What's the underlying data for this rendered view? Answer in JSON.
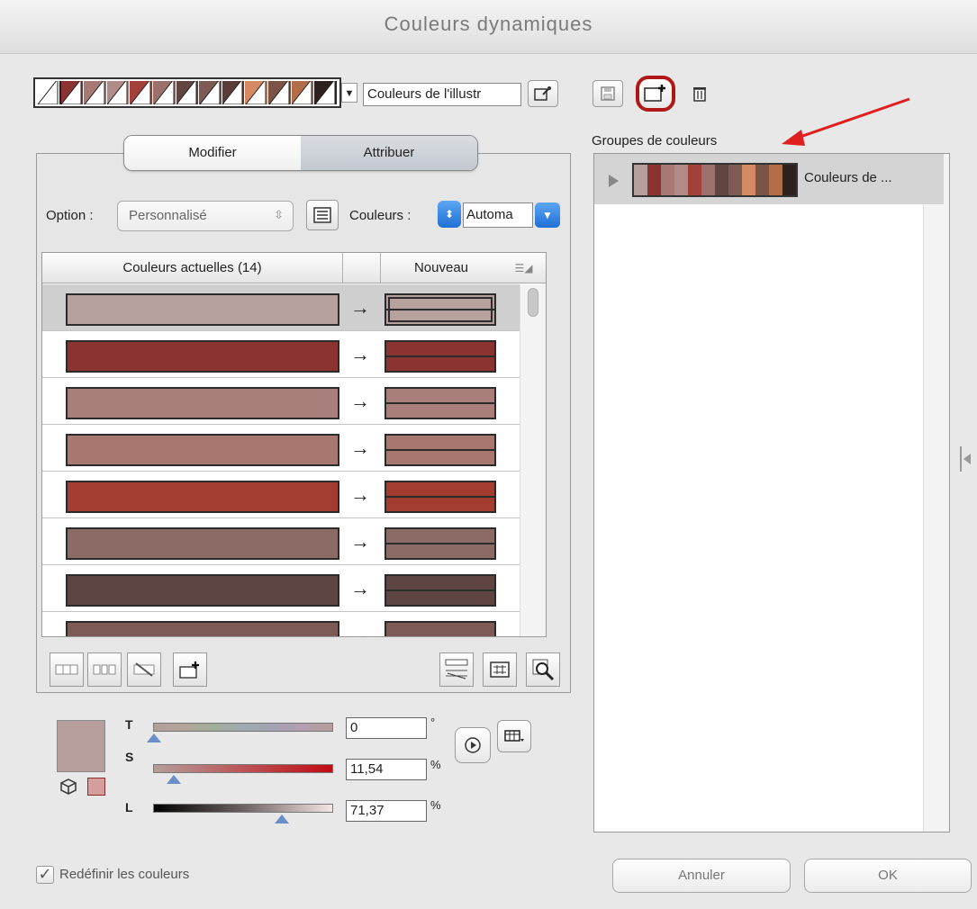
{
  "window": {
    "title": "Couleurs dynamiques"
  },
  "header": {
    "group_name_value": "Couleurs de l'illustr",
    "strip_colors": [
      "#ffffff",
      "#8a3330",
      "#a87874",
      "#b08b87",
      "#a3403a",
      "#9a716d",
      "#614540",
      "#7d5a53",
      "#5c3c38",
      "#d58a64",
      "#7b5447",
      "#b36d48",
      "#2d2120"
    ]
  },
  "tabs": {
    "modify": "Modifier",
    "assign": "Attribuer"
  },
  "options": {
    "option_label": "Option :",
    "option_value": "Personnalisé",
    "colors_label": "Couleurs :",
    "colors_value": "Automa"
  },
  "table": {
    "header_current": "Couleurs actuelles (14)",
    "header_new": "Nouveau",
    "rows": [
      {
        "color": "#b7a19e",
        "arrow": "→"
      },
      {
        "color": "#8a3330",
        "arrow": "→"
      },
      {
        "color": "#a87f7b",
        "arrow": "→"
      },
      {
        "color": "#a8776f",
        "arrow": "→"
      },
      {
        "color": "#a43d31",
        "arrow": "→"
      },
      {
        "color": "#8c6b66",
        "arrow": "→"
      },
      {
        "color": "#5e4541",
        "arrow": "→"
      },
      {
        "color": "#7d5a56",
        "arrow": "→"
      }
    ]
  },
  "sliders": {
    "h_label": "T",
    "h_value": "0",
    "h_unit": "°",
    "s_label": "S",
    "s_value": "11,54",
    "s_unit": "%",
    "l_label": "L",
    "l_value": "71,37",
    "l_unit": "%"
  },
  "groups": {
    "label": "Groupes de couleurs",
    "item_name": "Couleurs de ...",
    "item_colors": [
      "#b59e9b",
      "#8a3330",
      "#a87874",
      "#b08b87",
      "#a3403a",
      "#9a716d",
      "#614540",
      "#7d5a53",
      "#d58a64",
      "#7b5447",
      "#b36d48",
      "#2d2120"
    ]
  },
  "footer": {
    "redefine_label": "Redéfinir les couleurs",
    "redefine_checked": "✓",
    "cancel_label": "Annuler",
    "ok_label": "OK"
  }
}
